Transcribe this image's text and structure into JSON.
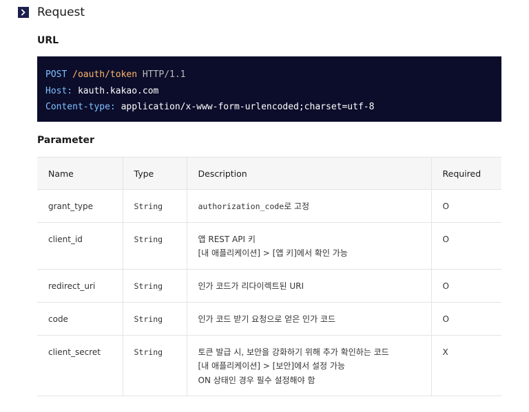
{
  "section": {
    "title": "Request"
  },
  "url": {
    "heading": "URL",
    "code": {
      "method": "POST",
      "path": "/oauth/token",
      "protocol": "HTTP/1.1",
      "host_key": "Host:",
      "host_value": "kauth.kakao.com",
      "content_type_key": "Content-type:",
      "content_type_value": "application/x-www-form-urlencoded;charset=utf-8"
    }
  },
  "parameter": {
    "heading": "Parameter",
    "columns": {
      "name": "Name",
      "type": "Type",
      "description": "Description",
      "required": "Required"
    },
    "rows": [
      {
        "name": "grant_type",
        "type": "String",
        "description_code": "authorization_code",
        "description_suffix": "로 고정",
        "required": "O"
      },
      {
        "name": "client_id",
        "type": "String",
        "description_lines": [
          "앱 REST API 키",
          "[내 애플리케이션] > [앱 키]에서 확인 가능"
        ],
        "required": "O"
      },
      {
        "name": "redirect_uri",
        "type": "String",
        "description_lines": [
          "인가 코드가 리다이렉트된 URI"
        ],
        "required": "O"
      },
      {
        "name": "code",
        "type": "String",
        "description_lines": [
          "인가 코드 받기 요청으로 얻은 인가 코드"
        ],
        "required": "O"
      },
      {
        "name": "client_secret",
        "type": "String",
        "description_lines": [
          "토큰 발급 시, 보안을 강화하기 위해 추가 확인하는 코드",
          "[내 애플리케이션] > [보안]에서 설정 가능",
          "ON 상태인 경우 필수 설정해야 함"
        ],
        "required": "X"
      }
    ]
  },
  "colors": {
    "code_background": "#0c0d2b",
    "chevron_box": "#1a1f4d",
    "code_keyword": "#7ec2ff",
    "code_path": "#ffb86c"
  },
  "icons": {
    "section_toggle": "chevron-right-icon"
  }
}
